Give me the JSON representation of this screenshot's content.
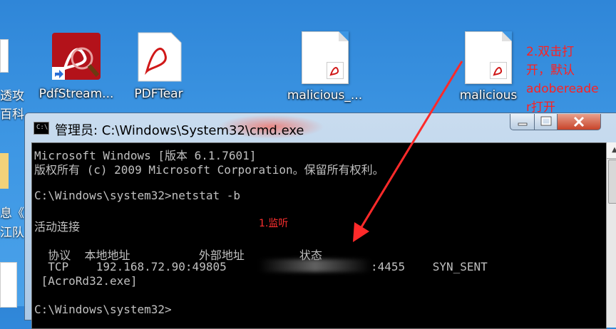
{
  "desktop": {
    "left_partial_labels": [
      "透攻",
      "百科.",
      "息《",
      "江队"
    ],
    "icons": [
      {
        "label": "PdfStream..."
      },
      {
        "label": "PDFTear"
      },
      {
        "label": "malicious_..."
      },
      {
        "label": "malicious"
      }
    ],
    "annotation": [
      "2.双击打",
      "开，默认",
      "adobereade",
      "r打开"
    ]
  },
  "window": {
    "title": "管理员: C:\\Windows\\System32\\cmd.exe",
    "console_lines": [
      "Microsoft Windows [版本 6.1.7601]",
      "版权所有 (c) 2009 Microsoft Corporation。保留所有权利。",
      "",
      "C:\\Windows\\system32>netstat -b",
      "",
      "活动连接",
      "",
      "  协议  本地地址          外部地址        状态",
      "  TCP    192.168.72.90:49805                     :4455    SYN_SENT",
      " [AcroRd32.exe]",
      "",
      "C:\\Windows\\system32>"
    ],
    "annotation_listen": "1.监听"
  },
  "colors": {
    "annotation": "#ff2020",
    "console_bg": "#000000",
    "console_fg": "#c0c0c0"
  }
}
